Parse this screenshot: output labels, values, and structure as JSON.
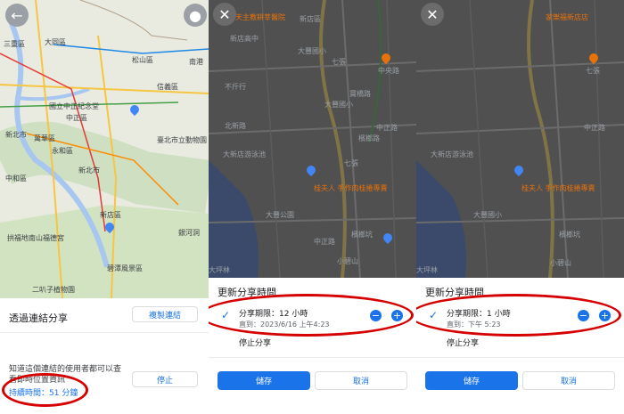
{
  "colors": {
    "accent": "#1a73e8",
    "annotation": "#d50000",
    "poi": "#e8710a"
  },
  "panel1": {
    "map_labels": [
      "三重區",
      "大同區",
      "松山區",
      "南港",
      "信義區",
      "國立中正紀念堂",
      "中正區",
      "新北市",
      "萬華區",
      "臺北市立動物園",
      "永和區",
      "中和區",
      "新北市",
      "新店區",
      "拱福地南山福德宮",
      "銀河洞",
      "碧潭風景區",
      "二叭子植物園"
    ],
    "route_shields": [
      "1",
      "3",
      "106",
      "3",
      "9"
    ],
    "sheet": {
      "title": "透過連結分享",
      "copy_link": "複製連結",
      "description_line1": "知道這個連結的使用者都可以查",
      "description_line2": "看即時位置資訊",
      "duration": "持續時間：51 分鐘",
      "stop": "停止"
    }
  },
  "panel2": {
    "map_labels": [
      "天主教耕莘醫院",
      "新店區",
      "新店高中",
      "大豐國小",
      "大新店游泳池",
      "大豐國小",
      "桂夫人 手作肉桂捲專賣",
      "檳榔坑",
      "大豐公園",
      "大坪林",
      "中央路",
      "七張",
      "七張",
      "中正路",
      "寶橋路",
      "檳榔路",
      "中正路",
      "小碧山",
      "不斤行",
      "北新路"
    ],
    "sheet": {
      "title": "更新分享時間",
      "option_title": "分享期限：12 小時",
      "option_sub": "直到：2023/6/16 上午4:23",
      "stop_sharing": "停止分享",
      "save": "儲存",
      "cancel": "取消"
    }
  },
  "panel3": {
    "map_labels": [
      "家樂福新店店",
      "大新店游泳池",
      "桂夫人 手作肉桂捲專賣",
      "檳榔坑",
      "中正路",
      "七張",
      "大豐國小",
      "大坪林",
      "小碧山"
    ],
    "sheet": {
      "title": "更新分享時間",
      "option_title": "分享期限：1 小時",
      "option_sub": "直到：下午 5:23",
      "stop_sharing": "停止分享",
      "save": "儲存",
      "cancel": "取消"
    }
  },
  "icons": {
    "back": "back-arrow-icon",
    "avatar": "person-icon",
    "close": "close-icon",
    "check": "check-icon",
    "minus": "minus-icon",
    "plus": "plus-icon"
  }
}
